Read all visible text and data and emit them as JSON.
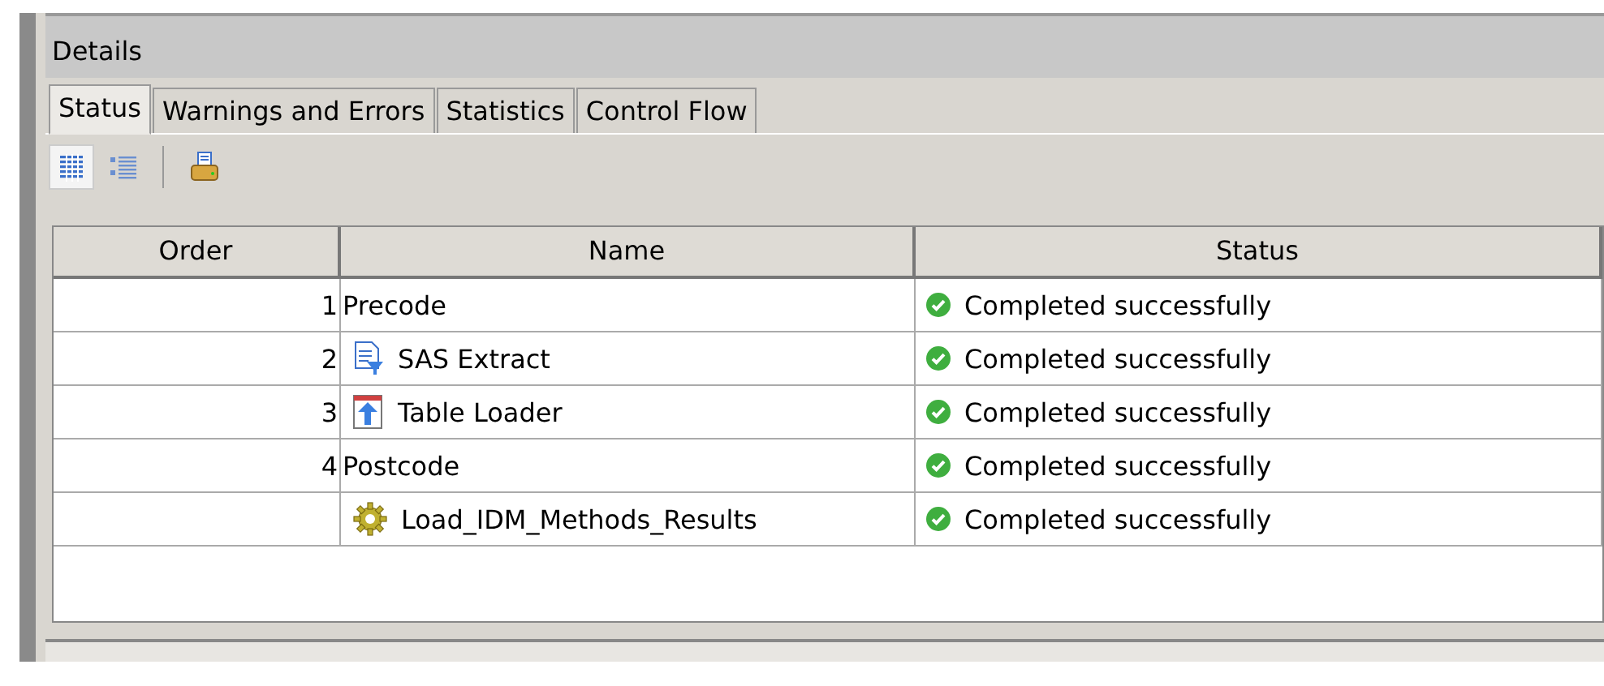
{
  "panel": {
    "title": "Details"
  },
  "tabs": [
    {
      "label": "Status",
      "selected": true
    },
    {
      "label": "Warnings and Errors",
      "selected": false
    },
    {
      "label": "Statistics",
      "selected": false
    },
    {
      "label": "Control Flow",
      "selected": false
    }
  ],
  "toolbar": [
    {
      "kind": "table",
      "selected": true
    },
    {
      "kind": "list",
      "selected": false
    },
    {
      "kind": "separator"
    },
    {
      "kind": "print",
      "selected": false
    }
  ],
  "table": {
    "columns": [
      "Order",
      "Name",
      "Status"
    ],
    "rows": [
      {
        "order": "1",
        "name": "Precode",
        "kind": "code",
        "status": "Completed successfully"
      },
      {
        "order": "2",
        "name": "SAS Extract",
        "kind": "extract",
        "status": "Completed successfully"
      },
      {
        "order": "3",
        "name": "Table Loader",
        "kind": "loader",
        "status": "Completed successfully"
      },
      {
        "order": "4",
        "name": "Postcode",
        "kind": "code",
        "status": "Completed successfully"
      },
      {
        "name": "Load_IDM_Methods_Results",
        "kind": "job",
        "status": "Completed successfully"
      }
    ]
  }
}
